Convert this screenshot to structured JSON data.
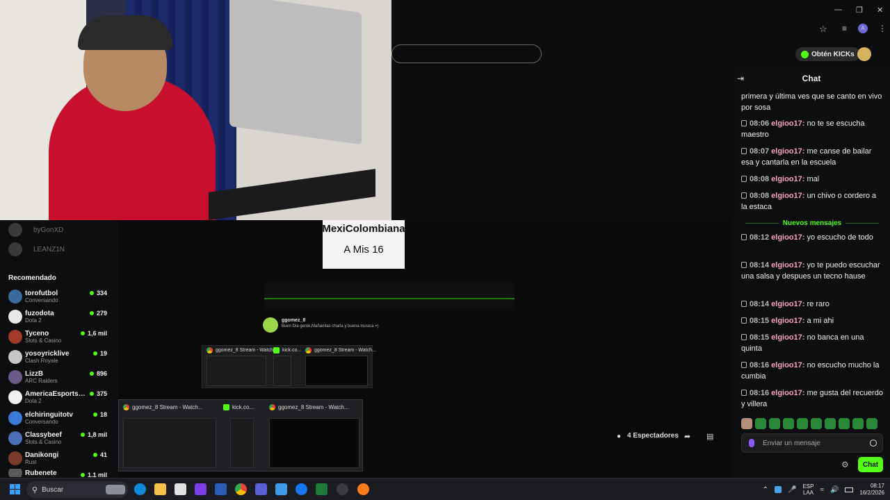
{
  "sidebar": {
    "offline": [
      {
        "name": "byGonXD"
      },
      {
        "name": "LEANZ1N"
      }
    ],
    "recommended_title": "Recomendado",
    "recommended": [
      {
        "name": "torofutbol",
        "sub": "Conversando",
        "count": "334",
        "color": "#3a6b9a"
      },
      {
        "name": "fuzodota",
        "sub": "Dota 2",
        "count": "279",
        "color": "#e8e8e8"
      },
      {
        "name": "Tyceno",
        "sub": "Slots & Casino",
        "count": "1,6 mil",
        "color": "#a33b2a"
      },
      {
        "name": "yosoyricklive",
        "sub": "Clash Royale",
        "count": "19",
        "color": "#c8c8c8"
      },
      {
        "name": "LizzB",
        "sub": "ARC Raiders",
        "count": "896",
        "color": "#6a5a8a"
      },
      {
        "name": "AmericaEsportsD...",
        "sub": "Dota 2",
        "count": "375",
        "color": "#f0f0f0"
      },
      {
        "name": "elchiringuitotv",
        "sub": "Conversando",
        "count": "18",
        "color": "#3a7bd5"
      },
      {
        "name": "Classybeef",
        "sub": "Slots & Casino",
        "count": "1,8 mil",
        "color": "#4a6fb5"
      },
      {
        "name": "Danikongi",
        "sub": "Rust",
        "count": "41",
        "color": "#7a3b2a"
      },
      {
        "name": "Rubenete",
        "sub": "",
        "count": "1,1 mil",
        "color": "#5a5a5a"
      }
    ]
  },
  "popups": {
    "tab1": "ggomez_8 Stream - Watch...",
    "tab2": "kick.co...",
    "tab3": "ggomez_8 Stream - Watch..."
  },
  "nested": {
    "banner_title": "MexiColombiana",
    "banner_sub": "A Mis 16",
    "streamer": "ggomez_8",
    "stream_title": "Buen Dia gente,Mañanitas charla y buena musica =)"
  },
  "header": {
    "kicks_label": "Obtén KICKs"
  },
  "chat": {
    "title": "Chat",
    "intro": "primera y última ves que se canto en vivo por sosa",
    "messages_before": [
      {
        "time": "08:06",
        "user": "elgioo17",
        "text": "no te se escucha maestro"
      },
      {
        "time": "08:07",
        "user": "elgioo17",
        "text": "me canse de bailar esa y cantarla en la escuela"
      },
      {
        "time": "08:08",
        "user": "elgioo17",
        "text": "mal"
      },
      {
        "time": "08:08",
        "user": "elgioo17",
        "text": "un chivo o cordero a la estaca"
      }
    ],
    "divider": "Nuevos mensajes",
    "messages_after": [
      {
        "time": "08:12",
        "user": "elgioo17",
        "text": "yo escucho de todo"
      },
      {
        "time": "08:14",
        "user": "elgioo17",
        "text": "yo te puedo escuchar una salsa y despues un tecno hause"
      },
      {
        "time": "08:14",
        "user": "elgioo17",
        "text": "re raro"
      },
      {
        "time": "08:15",
        "user": "elgioo17",
        "text": "a mi ahi"
      },
      {
        "time": "08:15",
        "user": "elgioo17",
        "text": "no banca en una quinta"
      },
      {
        "time": "08:16",
        "user": "elgioo17",
        "text": "no escucho mucho la cumbia"
      },
      {
        "time": "08:16",
        "user": "elgioo17",
        "text": "me gusta del recuerdo y villera"
      }
    ],
    "input_placeholder": "Enviar un mensaje",
    "send_label": "Chat"
  },
  "viewers": {
    "label": "4 Espectadores"
  },
  "taskbar": {
    "search_label": "Buscar",
    "lang_top": "ESP",
    "lang_bottom": "LAA",
    "time": "08:17",
    "date": "16/2/2026"
  },
  "colors": {
    "accent": "#53fc18",
    "username": "#f6a1c0",
    "live": "#53fc18"
  }
}
